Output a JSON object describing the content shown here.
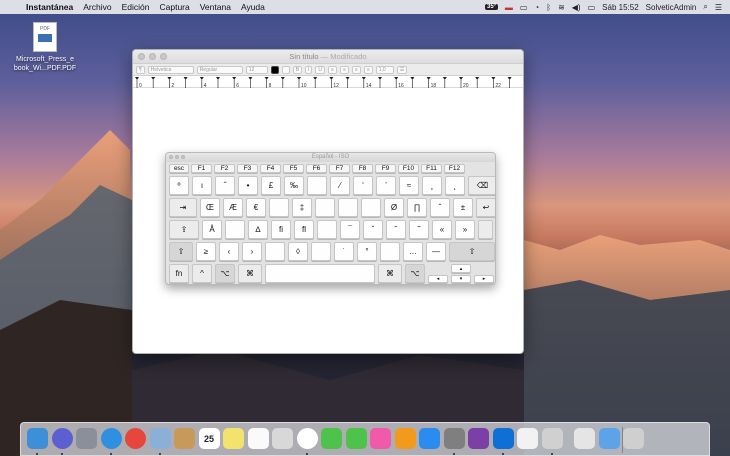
{
  "menubar": {
    "apple": "",
    "app": "Instantánea",
    "items": [
      "Archivo",
      "Edición",
      "Captura",
      "Ventana",
      "Ayuda"
    ],
    "temp": "35º",
    "clock": "Sáb 15:52",
    "user": "SolveticAdmin"
  },
  "desktop": {
    "file_badge": "PDF",
    "file_name": "Microsoft_Press_e book_Wi...PDF.PDF"
  },
  "window": {
    "title": "Sin título",
    "modified": "— Modificado",
    "toolbar": {
      "font": "Helvetica",
      "style": "Regular",
      "size": "12",
      "spacing": "1,0"
    },
    "ruler_numbers": [
      "0",
      "2",
      "4",
      "6",
      "8",
      "10",
      "12",
      "14",
      "16",
      "18",
      "20",
      "22"
    ]
  },
  "keyboard": {
    "title": "Español - ISO",
    "function_row": [
      "esc",
      "F1",
      "F2",
      "F3",
      "F4",
      "F5",
      "F6",
      "F7",
      "F8",
      "F9",
      "F10",
      "F11",
      "F12"
    ],
    "row1": [
      "º",
      "ı",
      "˝",
      "•",
      "£",
      "‰",
      "",
      "⁄",
      "‘",
      "’",
      "≈",
      "¸",
      "˛",
      "⌫"
    ],
    "row2": [
      "⇥",
      "Œ",
      "Æ",
      "€",
      "",
      "‡",
      "",
      "",
      "",
      "Ø",
      "∏",
      "ˆ",
      "±",
      "↩"
    ],
    "row3": [
      "⇪",
      "Å",
      "",
      "∆",
      "ﬁ",
      "ﬂ",
      "",
      "¯",
      "ˇ",
      "˘",
      "˜",
      "«",
      "»"
    ],
    "row4": [
      "⇧",
      "≥",
      "‹",
      "›",
      "",
      "◊",
      "",
      "˙",
      "°",
      "",
      "…",
      "—",
      "⇧"
    ],
    "row5": [
      "fn",
      "^",
      "⌥",
      "⌘",
      "",
      "⌘",
      "⌥"
    ],
    "arrows": [
      "▴",
      "◂",
      "▾",
      "▸"
    ]
  },
  "dock": {
    "calendar_day": "25",
    "icons": [
      "finder-icon",
      "siri-icon",
      "launchpad-icon",
      "safari-icon",
      "chrome-icon",
      "preview-icon",
      "notes-icon",
      "calendar-icon",
      "stickies-icon",
      "reminders-icon",
      "photo-booth-icon",
      "photos-icon",
      "messages-icon",
      "facetime-icon",
      "itunes-icon",
      "ibooks-icon",
      "app-store-icon",
      "system-preferences-icon",
      "onenote-icon",
      "teamviewer-icon",
      "textedit-icon",
      "preview-app-icon",
      "documents-folder-icon",
      "downloads-folder-icon",
      "trash-icon"
    ],
    "colors": {
      "finder": "#3d8fd8",
      "safari": "#2f8fe0",
      "chrome": "#e6463b",
      "itunes": "#f05aa8",
      "ibooks": "#f29a1b",
      "app_store": "#2b8cf0",
      "messages": "#4fc24b",
      "onenote": "#7b3fa6",
      "teamviewer": "#0e6fd6"
    }
  }
}
